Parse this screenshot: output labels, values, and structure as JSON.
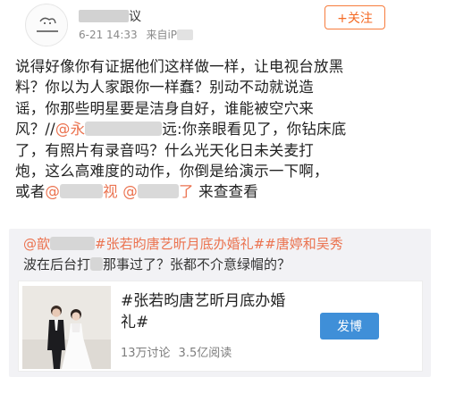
{
  "header": {
    "username_suffix": "议",
    "timestamp": "6-21 14:33",
    "source_prefix": "来自iP",
    "follow_label": "+关注"
  },
  "post": {
    "lines": [
      "说得好像你有证据他们这样做一样，让电视台放黑",
      "料？你以为人家跟你一样蠢？别动不动就说造",
      "谣，你那些明星要是洁身自好，谁能被空穴来"
    ],
    "line4_a": "风？//",
    "line4_mention": "@永",
    "line4_b": "远:你亲眼看见了，你钻床底",
    "line5": "了，有照片有录音吗？什么光天化日未关麦打",
    "line6": "炮，这么高难度的动作，你倒是给演示一下啊，",
    "line7_a": "或者",
    "line7_mention1": "@",
    "line7_mention1_end": "视",
    "line7_mention2": "@",
    "line7_mention2_end": "了",
    "line7_b": " 来查查看"
  },
  "repost": {
    "mention": "@歆",
    "tag1": "#张若昀唐艺昕月底办婚礼#",
    "tag2": "#唐婷和吴秀",
    "line2_a": "波在后台打",
    "line2_b": "那事过了？张都不介意绿帽的？",
    "card": {
      "title": "#张若昀唐艺昕月底办婚礼#",
      "discussions": "13万讨论",
      "reads": "3.5亿阅读",
      "button_label": "发博"
    }
  },
  "colors": {
    "accent": "#eb7350",
    "follow": "#f46a24",
    "button_blue": "#3f8fd8",
    "repost_bg": "#f2f2f5"
  }
}
